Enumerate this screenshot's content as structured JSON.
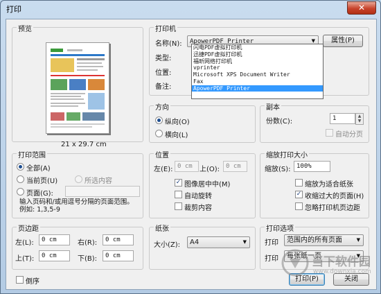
{
  "window": {
    "title": "打印",
    "close": "✕"
  },
  "preview": {
    "title": "预览",
    "size": "21 x 29.7 cm"
  },
  "printer": {
    "title": "打印机",
    "name_label": "名称(N):",
    "selected": "ApowerPDF Printer",
    "properties": "属性(P)",
    "type_label": "类型:",
    "location_label": "位置:",
    "comment_label": "备注:",
    "options": [
      "闪电PDF虚拟打印机",
      "迅捷PDF虚拟打印机",
      "福昕网络打印机",
      "vprinter",
      "Microsoft XPS Document Writer",
      "Fax",
      "ApowerPDF Printer"
    ]
  },
  "orientation": {
    "title": "方向",
    "portrait": "纵向(O)",
    "landscape": "横向(L)",
    "selected": "portrait"
  },
  "copies": {
    "title": "副本",
    "count_label": "份数(C):",
    "count": "1",
    "collate": "自动分页"
  },
  "range": {
    "title": "打印范围",
    "all": "全部(A)",
    "current": "当前页(U)",
    "selection": "所选内容",
    "pages": "页面(G):",
    "hint": "输入页码和/或用逗号分隔的页面范围。例如: 1,3,5-9"
  },
  "position": {
    "title": "位置",
    "left_label": "左(E):",
    "left_val": "0 cm",
    "top_label": "上(O):",
    "top_val": "0 cm",
    "center": "图像居中中(M)",
    "rotate": "自动旋转",
    "crop": "裁剪内容"
  },
  "scale": {
    "title": "缩放打印大小",
    "label": "缩放(S):",
    "value": "100%",
    "fit": "缩放为适合纸张",
    "shrink": "收缩过大的页面(H)",
    "ignore": "忽略打印机页边距"
  },
  "margins": {
    "title": "页边距",
    "left_label": "左(L):",
    "left_val": "0 cm",
    "right_label": "右(R):",
    "right_val": "0 cm",
    "top_label": "上(T):",
    "top_val": "0 cm",
    "bottom_label": "下(B):",
    "bottom_val": "0 cm"
  },
  "paper": {
    "title": "纸张",
    "size_label": "大小(Z):",
    "size": "A4"
  },
  "options": {
    "title": "打印选项",
    "print_label": "打印",
    "what": "范围内的所有页面",
    "print_label2": "打印",
    "per_sheet": "每张纸一页"
  },
  "footer": {
    "reverse": "倒序",
    "print": "打印(P)",
    "close": "关闭"
  },
  "watermark": {
    "text": "当下软件园",
    "url": "www.downxia.com"
  }
}
